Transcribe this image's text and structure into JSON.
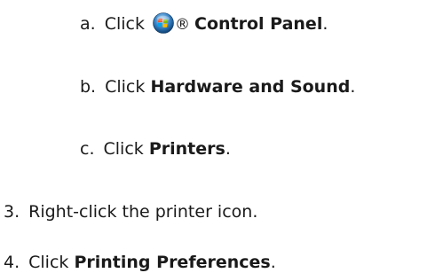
{
  "steps": {
    "a": {
      "marker": "a.",
      "prefix": "Click",
      "icon": "windows-start-orb-icon",
      "registered": "®",
      "bold": "Control Panel",
      "suffix": "."
    },
    "b": {
      "marker": "b.",
      "prefix": "Click",
      "bold": "Hardware and Sound",
      "suffix": "."
    },
    "c": {
      "marker": "c.",
      "prefix": "Click",
      "bold": "Printers",
      "suffix": "."
    },
    "s3": {
      "marker": "3.",
      "text": "Right-click the printer icon."
    },
    "s4": {
      "marker": "4.",
      "prefix": "Click",
      "bold": "Printing Preferences",
      "suffix": "."
    }
  }
}
